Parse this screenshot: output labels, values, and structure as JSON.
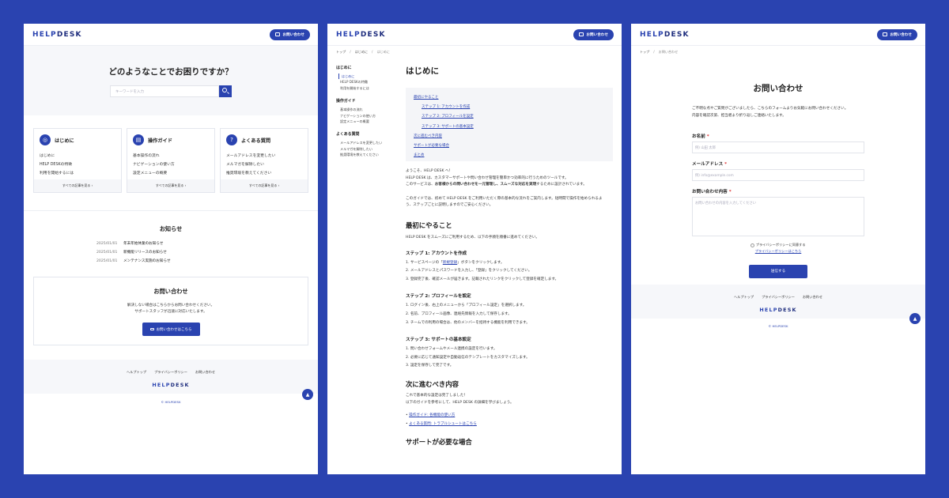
{
  "brand": {
    "logo_a": "HELP",
    "logo_b": "DESK",
    "contact_button": "お問い合わせ"
  },
  "home": {
    "hero_title": "どのようなことでお困りですか？",
    "search_placeholder": "キーワードを入力",
    "cards": [
      {
        "title": "はじめに",
        "icon": "map-pin-icon",
        "items": [
          "はじめに",
          "HELP DESKの特徴",
          "利用を開始するには"
        ],
        "more": "すべての記事を見る"
      },
      {
        "title": "操作ガイド",
        "icon": "book-icon",
        "items": [
          "基本操作の流れ",
          "ナビゲーションの使い方",
          "設定メニューの概要"
        ],
        "more": "すべての記事を見る"
      },
      {
        "title": "よくある質問",
        "icon": "chat-question-icon",
        "items": [
          "メールアドレスを変更したい",
          "メルマガを解除したい",
          "推奨環境を教えてください"
        ],
        "more": "すべての記事を見る"
      }
    ],
    "news_title": "お知らせ",
    "news": [
      {
        "date": "2025/01/01",
        "title": "年末年始休業のお知らせ"
      },
      {
        "date": "2025/01/01",
        "title": "新機能リリースのお知らせ"
      },
      {
        "date": "2025/01/01",
        "title": "メンテナンス実施のお知らせ"
      }
    ],
    "contact_title": "お問い合わせ",
    "contact_text_1": "解決しない場合はこちらからお問い合わせください。",
    "contact_text_2": "サポートスタッフが迅速に対応いたします。",
    "contact_button": "お問い合わせはこちら"
  },
  "footer": {
    "links": [
      "ヘルプトップ",
      "プライバシーポリシー",
      "お問い合わせ"
    ],
    "logo_a": "HELP",
    "logo_b": "DESK",
    "copyright": "© HELPDESK"
  },
  "guide": {
    "breadcrumb": [
      "トップ",
      "はじめに",
      "はじめに"
    ],
    "sidebar": [
      {
        "heading": "はじめに",
        "items": [
          "はじめに",
          "HELP DESKの特徴",
          "利用を開始するには"
        ]
      },
      {
        "heading": "操作ガイド",
        "items": [
          "基本操作の流れ",
          "ナビゲーションの使い方",
          "設定メニューの概要"
        ]
      },
      {
        "heading": "よくある質問",
        "items": [
          "メールアドレスを変更したい",
          "メルマガを解除したい",
          "推奨環境を教えてください"
        ]
      }
    ],
    "title": "はじめに",
    "toc": [
      "最初にやること",
      "ステップ 1: アカウントを作成",
      "ステップ 2: プロフィールを設定",
      "ステップ 3: サポートの基本設定",
      "次に進むべき内容",
      "サポートが必要な場合",
      "まとめ"
    ],
    "intro_1": "ようこそ、HELP DESK へ！",
    "intro_2": "HELP DESK は、カスタマーサポートや問い合わせ管理を簡単かつ効率的に行うためのツールです。",
    "intro_3a": "このサービスは、",
    "intro_3b": "お客様からの問い合わせを一元管理し、スムーズな対応を実現",
    "intro_3c": "するために設計されています。",
    "intro_4": "このガイドでは、初めて HELP DESK をご利用いただく際の基本的な流れをご案内します。短時間で操作を始められるよ",
    "intro_5": "う、ステップごとに説明しますのでご安心ください。",
    "s1_title": "最初にやること",
    "s1_text": "HELP DESK をスムーズにご利用するため、以下の手順を順番に進めてください。",
    "st1": "ステップ 1: アカウントを作成",
    "st1_1a": "1. サービスページの「",
    "st1_1b": "新規登録",
    "st1_1c": "」ボタンをクリックします。",
    "st1_2": "2. メールアドレスとパスワードを入力し、「登録」をクリックしてください。",
    "st1_3": "3. 登録完了後、確認メールが届きます。記載されたリンクをクリックして登録を確定します。",
    "st2": "ステップ 2: プロフィールを設定",
    "st2_1": "1. ログイン後、右上のメニューから「プロフィール設定」を選択します。",
    "st2_2": "2. 名前、プロフィール画像、連絡先情報を入力して保存します。",
    "st2_3": "3. チームでの利用の場合は、他のメンバーを招待する機能を利用できます。",
    "st3": "ステップ 3: サポートの基本設定",
    "st3_1": "1. 問い合わせフォームやメール連携の設定を行います。",
    "st3_2": "2. 必要に応じて通知設定や自動返信のテンプレートをカスタマイズします。",
    "st3_3": "3. 設定を保存して完了です。",
    "next_title": "次に進むべき内容",
    "next_1": "これで基本的な設定は完了しました！",
    "next_2": "以下のガイドを参考にして、HELP DESK の詳細を学びましょう。",
    "next_links": [
      "操作ガイド: 各機能の使い方",
      "よくある質問: トラブルシュートはこちら"
    ],
    "support_title": "サポートが必要な場合"
  },
  "contact": {
    "breadcrumb": [
      "トップ",
      "お問い合わせ"
    ],
    "title": "お問い合わせ",
    "desc_1": "ご不明な点やご質問がございましたら、こちらのフォームよりお気軽にお問い合わせください。",
    "desc_2": "内容を確認次第、担当者より折り返しご連絡いたします。",
    "name_label": "お名前",
    "name_placeholder": "例) 山田 太郎",
    "email_label": "メールアドレス",
    "email_placeholder": "例) info@example.com",
    "message_label": "お問い合わせ内容",
    "message_placeholder": "お問い合わせの内容を入力してください",
    "required_mark": "*",
    "privacy_agree": "プライバシーポリシーに同意する",
    "privacy_link": "プライバシーポリシーはこちら",
    "submit": "送信する"
  },
  "colors": {
    "accent": "#2a43b0",
    "background": "#2a43b0",
    "panel": "#ffffff"
  }
}
